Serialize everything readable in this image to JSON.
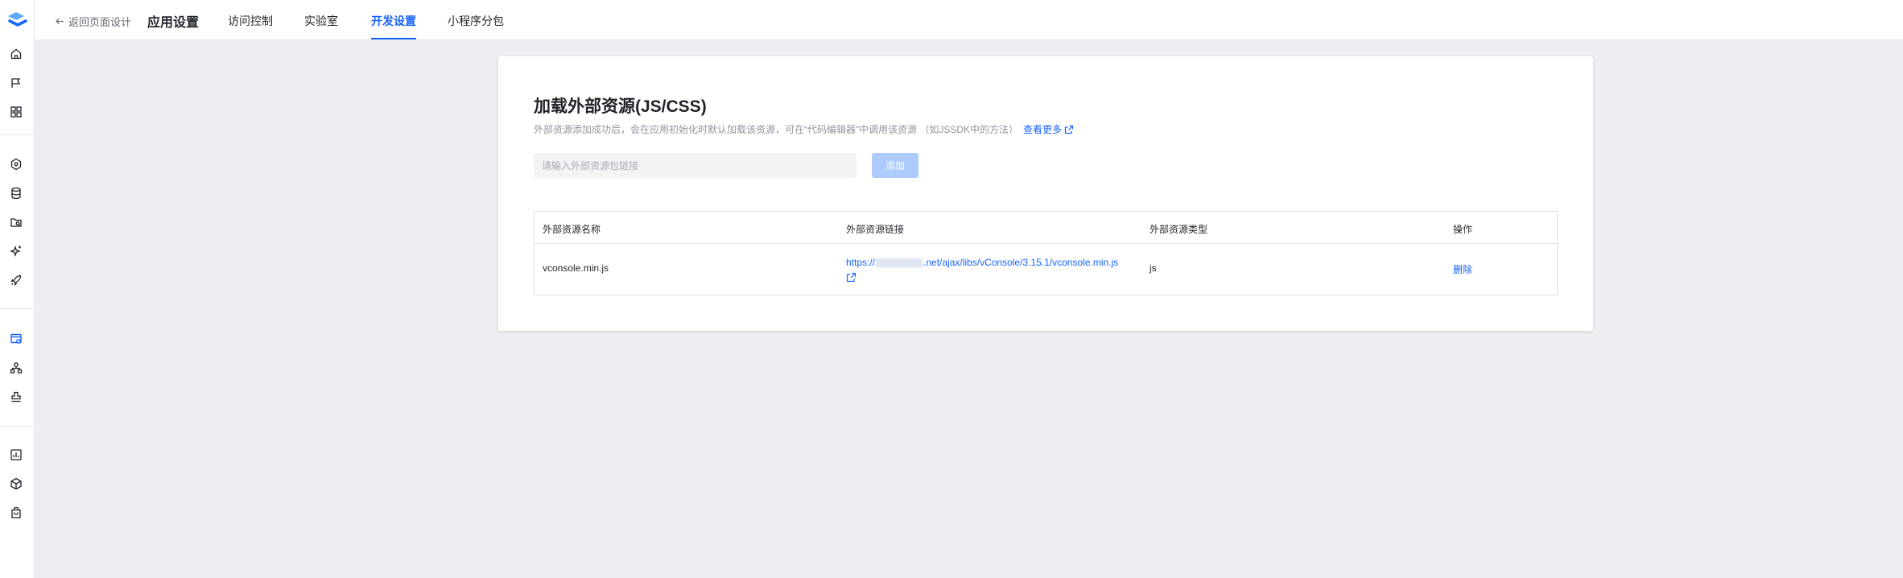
{
  "topbar": {
    "back_label": "返回页面设计",
    "app_title": "应用设置",
    "tabs": [
      {
        "label": "访问控制"
      },
      {
        "label": "实验室"
      },
      {
        "label": "开发设置",
        "active": true
      },
      {
        "label": "小程序分包"
      }
    ]
  },
  "sidebar": {
    "icons": [
      "home-icon",
      "flag-icon",
      "apps-icon",
      "hexagon-icon",
      "database-icon",
      "folder-search-icon",
      "sparkle-icon",
      "rocket-icon",
      "browser-settings-icon",
      "org-chart-icon",
      "stamp-icon",
      "chart-icon",
      "cube-icon",
      "bag-icon"
    ],
    "active_icon": "browser-settings-icon"
  },
  "card": {
    "title": "加载外部资源(JS/CSS)",
    "description": "外部资源添加成功后，会在应用初始化时默认加载该资源，可在“代码编辑器”中调用该资源 （如JSSDK中的方法）",
    "more_label": "查看更多",
    "input_placeholder": "请输入外部资源包链接",
    "add_label": "添加"
  },
  "table": {
    "columns": [
      "外部资源名称",
      "外部资源链接",
      "外部资源类型",
      "操作"
    ],
    "rows": [
      {
        "name": "vconsole.min.js",
        "link_prefix": "https://",
        "link_suffix": ".net/ajax/libs/vConsole/3.15.1/vconsole.min.js",
        "type": "js",
        "action": "删除"
      }
    ]
  },
  "colors": {
    "accent": "#1664ff",
    "background": "#eeeff2",
    "disabled_button": "#aecbfd"
  }
}
